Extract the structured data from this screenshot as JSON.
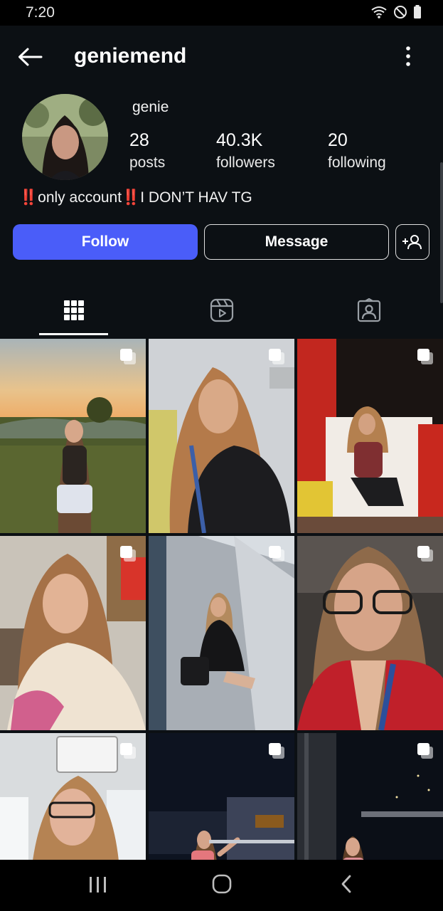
{
  "status_bar": {
    "time": "7:20"
  },
  "profile": {
    "username": "geniemend",
    "display_name": "genie",
    "stats": [
      {
        "value": "28",
        "label": "posts"
      },
      {
        "value": "40.3K",
        "label": "followers"
      },
      {
        "value": "20",
        "label": "following"
      }
    ],
    "bio": {
      "prefix": "‼️",
      "part1": "only account",
      "mid": "‼️",
      "part2": "I DON’T HAV TG"
    }
  },
  "buttons": {
    "follow": "Follow",
    "message": "Message",
    "suggest_icon": "add-person-icon"
  },
  "tabs": [
    "grid-icon",
    "reels-icon",
    "tagged-icon"
  ],
  "selected_tab": 0,
  "posts": [
    {
      "id": 1,
      "multi": true
    },
    {
      "id": 2,
      "multi": true
    },
    {
      "id": 3,
      "multi": true
    },
    {
      "id": 4,
      "multi": true
    },
    {
      "id": 5,
      "multi": true
    },
    {
      "id": 6,
      "multi": true
    },
    {
      "id": 7,
      "multi": true
    },
    {
      "id": 8,
      "multi": true
    },
    {
      "id": 9,
      "multi": true
    }
  ],
  "colors": {
    "background": "#0c1014",
    "accent": "#4a5df9"
  }
}
